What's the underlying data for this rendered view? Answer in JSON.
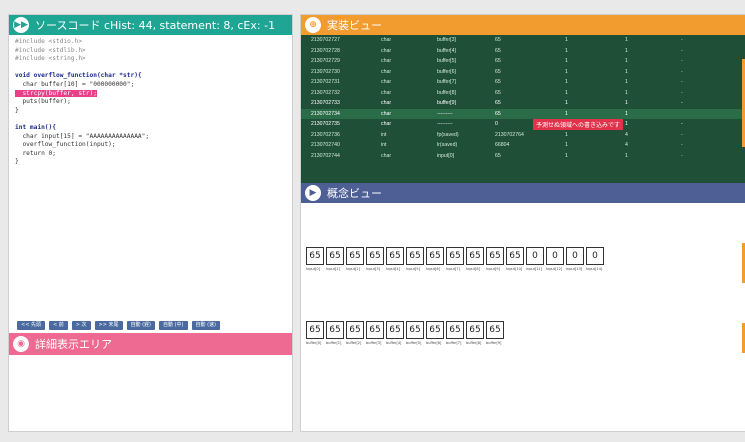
{
  "source_view": {
    "title": "ソースコード cHist: 44, statement: 8, cEx: -1",
    "code_lines": [
      {
        "text": "#include <stdio.h>",
        "kind": "inc"
      },
      {
        "text": "#include <stdlib.h>",
        "kind": "inc"
      },
      {
        "text": "#include <string.h>",
        "kind": "inc"
      },
      {
        "text": "",
        "kind": "plain"
      },
      {
        "text": "void overflow_function(char *str){",
        "kind": "kw"
      },
      {
        "text": "  char buffer[10] = \"000000000\";",
        "kind": "plain"
      },
      {
        "text": "  strcpy(buffer, str);",
        "kind": "hl"
      },
      {
        "text": "  puts(buffer);",
        "kind": "plain"
      },
      {
        "text": "}",
        "kind": "plain"
      },
      {
        "text": "",
        "kind": "plain"
      },
      {
        "text": "int main(){",
        "kind": "kw"
      },
      {
        "text": "  char input[15] = \"AAAAAAAAAAAAAA\";",
        "kind": "plain"
      },
      {
        "text": "  overflow_function(input);",
        "kind": "plain"
      },
      {
        "text": "  return 0;",
        "kind": "plain"
      },
      {
        "text": "}",
        "kind": "plain"
      }
    ]
  },
  "toolbar": {
    "buttons": [
      "<< 先頭",
      "< 前",
      "> 次",
      ">> 末尾",
      "自動 (遅)",
      "自動 (中)",
      "自動 (速)"
    ]
  },
  "detail_view": {
    "title": "詳細表示エリア"
  },
  "impl_view": {
    "title": "実装ビュー",
    "warning": "予測せぬ領域への書き込みです",
    "rows": [
      {
        "addr": "2130702727",
        "type": "char",
        "name": "buffer[3]",
        "value": "65",
        "size": "1",
        "count": "1",
        "extra": "-"
      },
      {
        "addr": "2130702728",
        "type": "char",
        "name": "buffer[4]",
        "value": "65",
        "size": "1",
        "count": "1",
        "extra": "-"
      },
      {
        "addr": "2130702729",
        "type": "char",
        "name": "buffer[5]",
        "value": "65",
        "size": "1",
        "count": "1",
        "extra": "-"
      },
      {
        "addr": "2130702730",
        "type": "char",
        "name": "buffer[6]",
        "value": "65",
        "size": "1",
        "count": "1",
        "extra": "-"
      },
      {
        "addr": "2130702731",
        "type": "char",
        "name": "buffer[7]",
        "value": "65",
        "size": "1",
        "count": "1",
        "extra": "-"
      },
      {
        "addr": "2130702732",
        "type": "char",
        "name": "buffer[8]",
        "value": "65",
        "size": "1",
        "count": "1",
        "extra": "-"
      },
      {
        "addr": "2130702733",
        "type": "char",
        "name": "buffer[9]",
        "value": "65",
        "size": "1",
        "count": "1",
        "extra": "-"
      },
      {
        "addr": "2130702734",
        "type": "char",
        "name": "---------",
        "value": "65",
        "size": "1",
        "count": "1",
        "extra": ""
      },
      {
        "addr": "2130702735",
        "type": "char",
        "name": "---------",
        "value": "0",
        "size": "1",
        "count": "1",
        "extra": "-"
      },
      {
        "addr": "2130702736",
        "type": "int",
        "name": "fp(saved)",
        "value": "2130702764",
        "size": "1",
        "count": "4",
        "extra": "-"
      },
      {
        "addr": "2130702740",
        "type": "int",
        "name": "lr(saved)",
        "value": "66804",
        "size": "1",
        "count": "4",
        "extra": "-"
      },
      {
        "addr": "2130702744",
        "type": "char",
        "name": "input[0]",
        "value": "65",
        "size": "1",
        "count": "1",
        "extra": "-"
      }
    ]
  },
  "concept_view": {
    "title": "概念ビュー",
    "input_values": [
      "65",
      "65",
      "65",
      "65",
      "65",
      "65",
      "65",
      "65",
      "65",
      "65",
      "65",
      "0",
      "0",
      "0",
      "0"
    ],
    "input_labels": [
      "input[0]",
      "input[1]",
      "input[2]",
      "input[3]",
      "input[4]",
      "input[5]",
      "input[6]",
      "input[7]",
      "input[8]",
      "input[9]",
      "input[10]",
      "input[11]",
      "input[12]",
      "input[13]",
      "input[14]"
    ],
    "buffer_values": [
      "65",
      "65",
      "65",
      "65",
      "65",
      "65",
      "65",
      "65",
      "65",
      "65"
    ],
    "buffer_labels": [
      "buffer[0]",
      "buffer[1]",
      "buffer[2]",
      "buffer[3]",
      "buffer[4]",
      "buffer[5]",
      "buffer[6]",
      "buffer[7]",
      "buffer[8]",
      "buffer[9]"
    ]
  },
  "colors": {
    "source_header": "#1fa594",
    "impl_header": "#f29b2e",
    "concept_header": "#4e5f96",
    "detail_header": "#ee6a92",
    "highlight": "#e83f88",
    "warning": "#e0334b"
  }
}
